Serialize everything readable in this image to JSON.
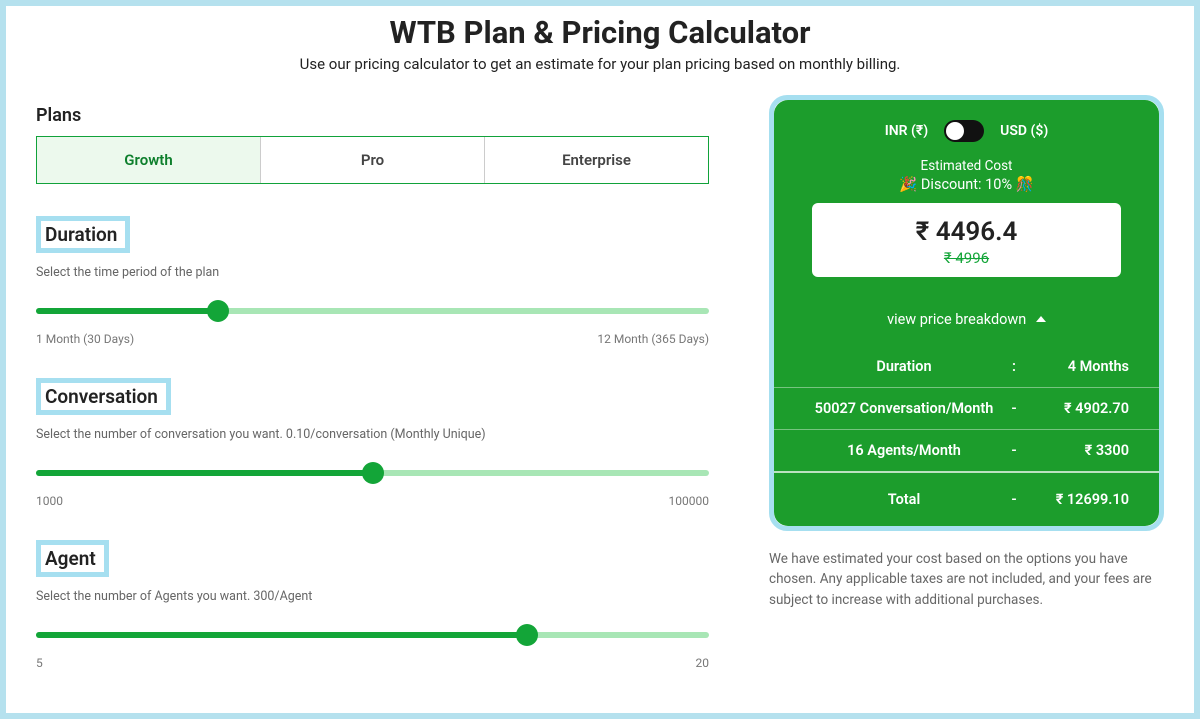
{
  "header": {
    "title": "WTB Plan & Pricing Calculator",
    "subtitle": "Use our pricing calculator to get an estimate for your plan pricing based on monthly billing."
  },
  "plans": {
    "label": "Plans",
    "tabs": [
      "Growth",
      "Pro",
      "Enterprise"
    ],
    "active_index": 0
  },
  "duration": {
    "title": "Duration",
    "desc": "Select the time period of the plan",
    "min_label": "1 Month (30 Days)",
    "max_label": "12 Month (365 Days)",
    "fill_percent": 27
  },
  "conversation": {
    "title": "Conversation",
    "desc": "Select the number of conversation you want. 0.10/conversation (Monthly Unique)",
    "min_label": "1000",
    "max_label": "100000",
    "fill_percent": 50
  },
  "agent": {
    "title": "Agent",
    "desc": "Select the number of Agents you want. 300/Agent",
    "min_label": "5",
    "max_label": "20",
    "fill_percent": 73
  },
  "est": {
    "currency_left": "INR (₹)",
    "currency_right": "USD ($)",
    "label": "Estimated Cost",
    "discount": "🎉 Discount: 10% 🎊",
    "price": "₹ 4496.4",
    "strike": "₹ 4996",
    "breakdown_label": "view price breakdown",
    "rows": [
      {
        "c1": "Duration",
        "c2": ":",
        "c3": "4 Months"
      },
      {
        "c1": "50027 Conversation/Month",
        "c2": "-",
        "c3": "₹ 4902.70"
      },
      {
        "c1": "16 Agents/Month",
        "c2": "-",
        "c3": "₹ 3300"
      }
    ],
    "total_label": "Total",
    "total_sep": "-",
    "total_value": "₹ 12699.10"
  },
  "disclaimer": "We have estimated your cost based on the options you have chosen. Any applicable taxes are not included, and your fees are subject to increase with additional purchases."
}
